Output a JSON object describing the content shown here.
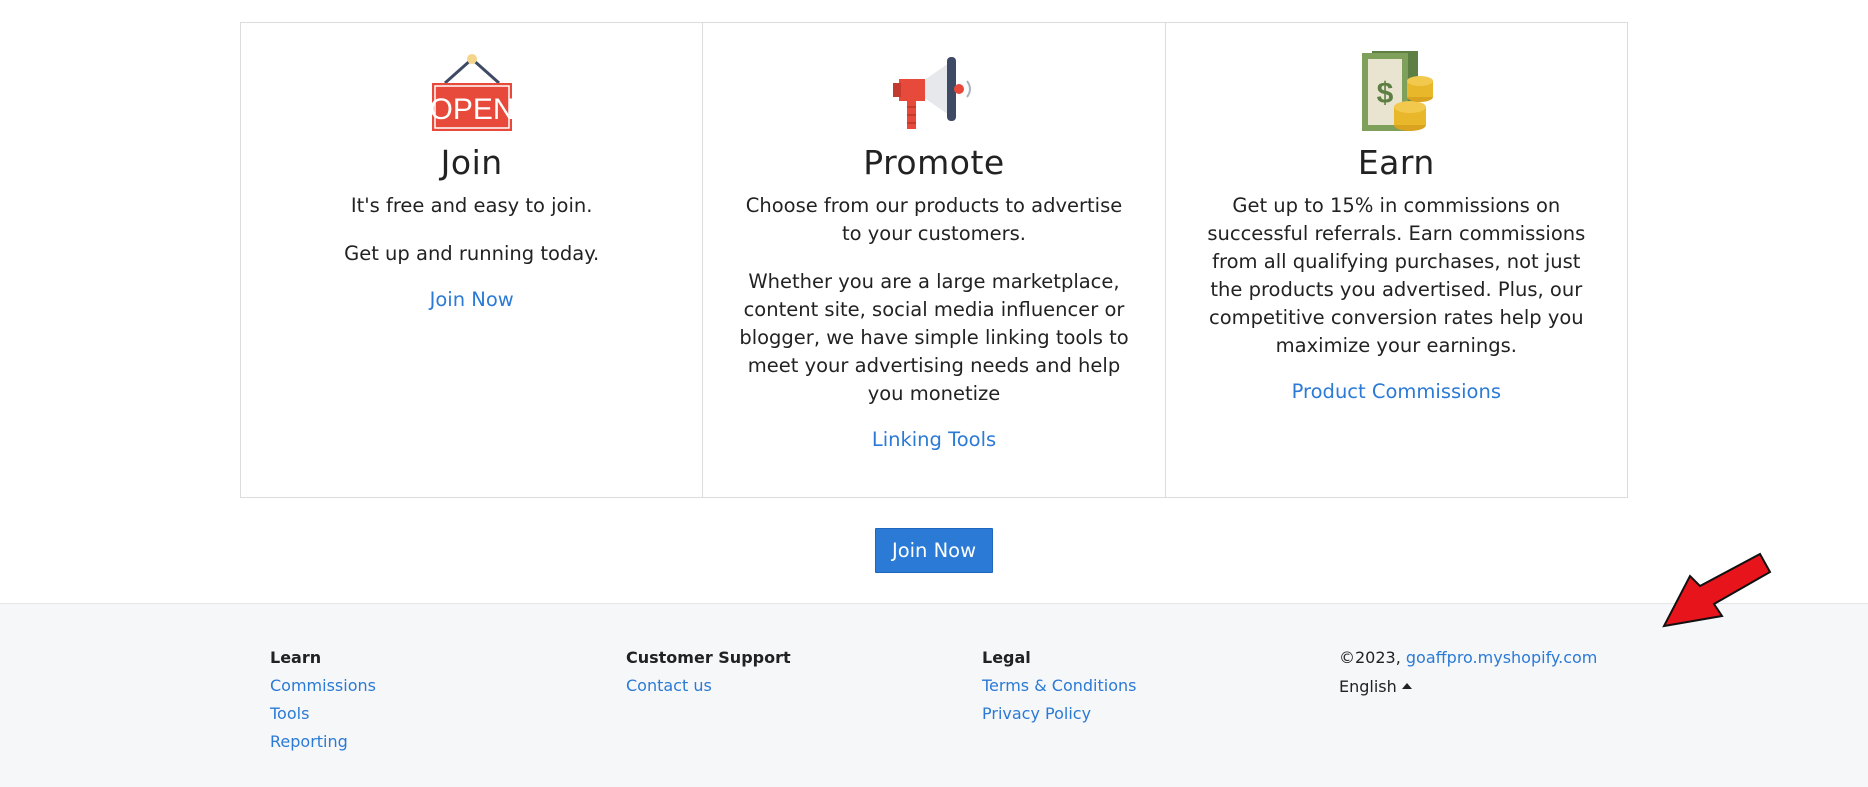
{
  "cards": [
    {
      "icon": "open-sign-icon",
      "title": "Join",
      "paragraphs": [
        "It's free and easy to join.",
        "Get up and running today."
      ],
      "link": "Join Now"
    },
    {
      "icon": "megaphone-icon",
      "title": "Promote",
      "paragraphs": [
        "Choose from our products to advertise to your customers.",
        "Whether you are a large marketplace, content site, social media influencer or blogger, we have simple linking tools to meet your advertising needs and help you monetize"
      ],
      "link": "Linking Tools"
    },
    {
      "icon": "money-coins-icon",
      "title": "Earn",
      "paragraphs": [
        "Get up to 15% in commissions on successful referrals. Earn commissions from all qualifying purchases, not just the products you advertised. Plus, our competitive conversion rates help you maximize your earnings."
      ],
      "link": "Product Commissions"
    }
  ],
  "icon_text": {
    "open_sign": "OPEN"
  },
  "cta": {
    "label": "Join Now"
  },
  "footer": {
    "learn": {
      "heading": "Learn",
      "links": [
        "Commissions",
        "Tools",
        "Reporting"
      ]
    },
    "support": {
      "heading": "Customer Support",
      "links": [
        "Contact us"
      ]
    },
    "legal": {
      "heading": "Legal",
      "links": [
        "Terms & Conditions",
        "Privacy Policy"
      ]
    },
    "copyright": "©2023, ",
    "site_link": "goaffpro.myshopify.com",
    "language": "English"
  },
  "colors": {
    "link": "#2a7ad6",
    "button": "#2a7ad6",
    "footer_bg": "#f6f7f8",
    "arrow": "#e8141b"
  }
}
